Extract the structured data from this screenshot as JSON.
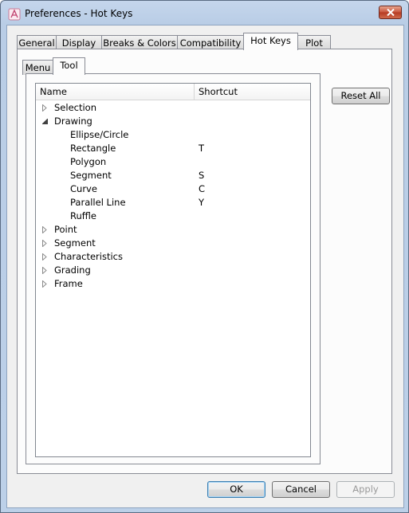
{
  "window": {
    "title": "Preferences - Hot Keys",
    "close_label": "✕"
  },
  "outer_tabs": [
    {
      "label": "General",
      "active": false
    },
    {
      "label": "Display",
      "active": false
    },
    {
      "label": "Breaks & Colors",
      "active": false
    },
    {
      "label": "Compatibility",
      "active": false
    },
    {
      "label": "Hot Keys",
      "active": true
    },
    {
      "label": "Plot",
      "active": false
    }
  ],
  "inner_tabs": [
    {
      "label": "Menu",
      "active": false
    },
    {
      "label": "Tool",
      "active": true
    }
  ],
  "reset_all_label": "Reset All",
  "tree": {
    "columns": {
      "name": "Name",
      "shortcut": "Shortcut"
    },
    "rows": [
      {
        "label": "Selection",
        "level": 0,
        "state": "collapsed",
        "shortcut": ""
      },
      {
        "label": "Drawing",
        "level": 0,
        "state": "expanded",
        "shortcut": ""
      },
      {
        "label": "Ellipse/Circle",
        "level": 1,
        "state": "leaf",
        "shortcut": ""
      },
      {
        "label": "Rectangle",
        "level": 1,
        "state": "leaf",
        "shortcut": "T"
      },
      {
        "label": "Polygon",
        "level": 1,
        "state": "leaf",
        "shortcut": ""
      },
      {
        "label": "Segment",
        "level": 1,
        "state": "leaf",
        "shortcut": "S"
      },
      {
        "label": "Curve",
        "level": 1,
        "state": "leaf",
        "shortcut": "C"
      },
      {
        "label": "Parallel Line",
        "level": 1,
        "state": "leaf",
        "shortcut": "Y"
      },
      {
        "label": "Ruffle",
        "level": 1,
        "state": "leaf",
        "shortcut": ""
      },
      {
        "label": "Point",
        "level": 0,
        "state": "collapsed",
        "shortcut": ""
      },
      {
        "label": "Segment",
        "level": 0,
        "state": "collapsed",
        "shortcut": ""
      },
      {
        "label": "Characteristics",
        "level": 0,
        "state": "collapsed",
        "shortcut": ""
      },
      {
        "label": "Grading",
        "level": 0,
        "state": "collapsed",
        "shortcut": ""
      },
      {
        "label": "Frame",
        "level": 0,
        "state": "collapsed",
        "shortcut": ""
      }
    ]
  },
  "buttons": {
    "ok": "OK",
    "cancel": "Cancel",
    "apply": "Apply"
  },
  "icons": {
    "app": "preferences-app-icon",
    "close": "close-icon",
    "collapsed": "tree-collapsed-arrow-icon",
    "expanded": "tree-expanded-arrow-icon"
  }
}
